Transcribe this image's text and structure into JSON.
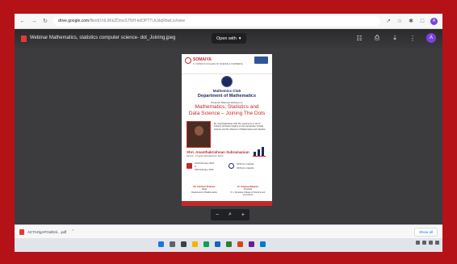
{
  "browser": {
    "url_host": "drive.google.com",
    "url_path": "/file/d/1NL9KkZDmxSTNH-kdOPTTUUdqRbwLiv/view"
  },
  "viewer": {
    "file_name": "Webinar Mathematics, statistics computer science- dot_Joining.jpeg",
    "open_with_label": "Open with",
    "avatar_letter": "A"
  },
  "poster": {
    "org_name": "SOMAIYA",
    "org_sub": "K J SOMAIYA COLLEGE OF SCIENCE & COMMERCE",
    "club": "Mathemics Club",
    "department": "Department of Mathematics",
    "presents": "Presents National Webinar on",
    "title_line1": "Mathematics, Statistics and",
    "title_line2": "Data Science – Joining The Dots",
    "bio": "Mr. Ananthakrishnan with 18+ experience in the IT industry will share insights on the intersection of Data Science and the influence of Mathematics and statistics.",
    "speaker_name": "Shri. Ananthakrishnan Subramanian",
    "speaker_role": "Director - Program Management, Zebra",
    "date1": "22nd February, 2022",
    "date_and": "&",
    "date2": "23rd February, 2022",
    "time1": "03:00 pm onwards",
    "time2": "03:00 pm onwards",
    "sig1_name": "Mr. Subhash Shahane",
    "sig1_role1": "Head",
    "sig1_role2": "Department of Mathematics",
    "sig2_name": "Dr. Pradeep Waghela",
    "sig2_role1": "Principal",
    "sig2_role2": "K.J. Somaiya College of Science and Commerce"
  },
  "zoom": {
    "minus": "−",
    "search": "⌕",
    "plus": "+"
  },
  "downloads": {
    "item_name": "ACTnOgAFOolDnl....pdf",
    "show_all": "Show all"
  },
  "colors": {
    "outer_border": "#b51218",
    "accent_red": "#c62828",
    "navy": "#1c2a5c",
    "avatar": "#7b3fe4"
  }
}
